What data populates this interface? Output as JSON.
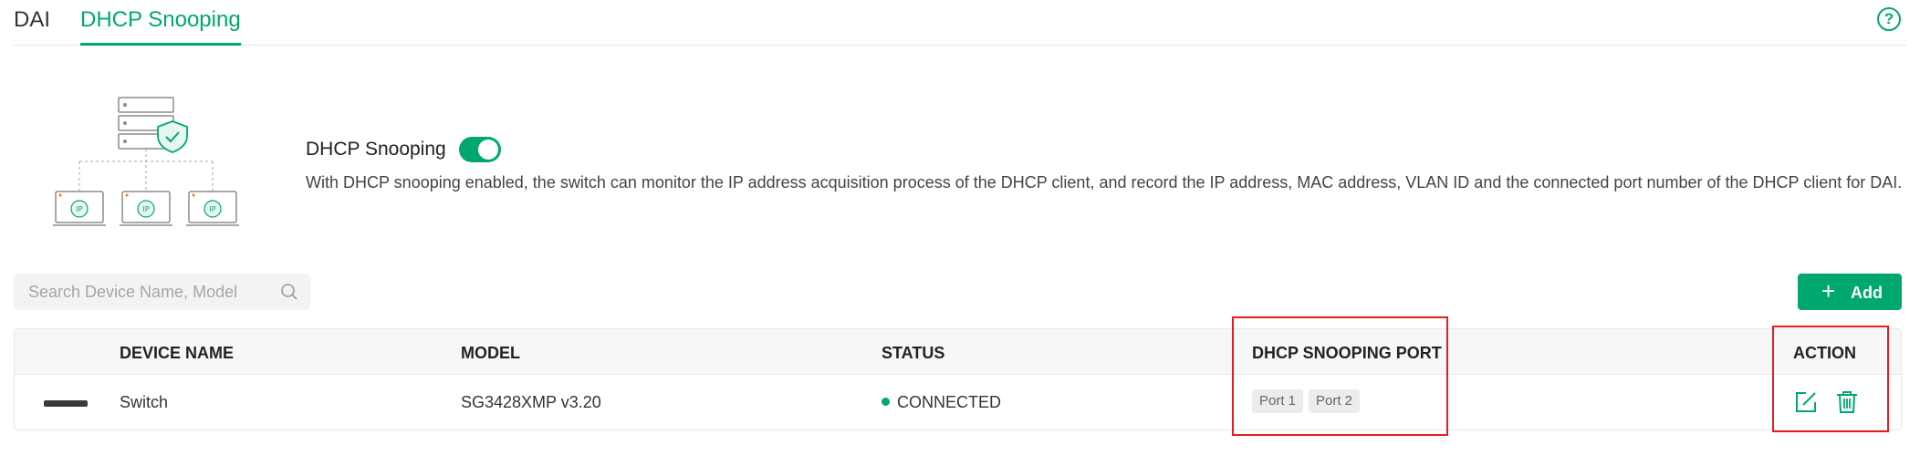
{
  "tabs": [
    {
      "label": "DAI",
      "active": false
    },
    {
      "label": "DHCP Snooping",
      "active": true
    }
  ],
  "help_icon": "question-circle-icon",
  "dhcp_snooping": {
    "title": "DHCP Snooping",
    "enabled": true,
    "description": "With DHCP snooping enabled, the switch can monitor the IP address acquisition process of the DHCP client, and record the IP address, MAC address, VLAN ID and the connected port number of the DHCP client for DAI."
  },
  "illustration": {
    "ip_label": "IP"
  },
  "search": {
    "placeholder": "Search Device Name, Model",
    "value": ""
  },
  "add_button": {
    "label": "Add"
  },
  "table": {
    "columns": [
      "DEVICE NAME",
      "MODEL",
      "STATUS",
      "DHCP SNOOPING PORT",
      "ACTION"
    ],
    "rows": [
      {
        "device_name": "Switch",
        "model": "SG3428XMP v3.20",
        "status": "CONNECTED",
        "ports": [
          "Port 1",
          "Port 2"
        ]
      }
    ]
  },
  "colors": {
    "accent": "#00a870",
    "highlight": "#e02020"
  }
}
